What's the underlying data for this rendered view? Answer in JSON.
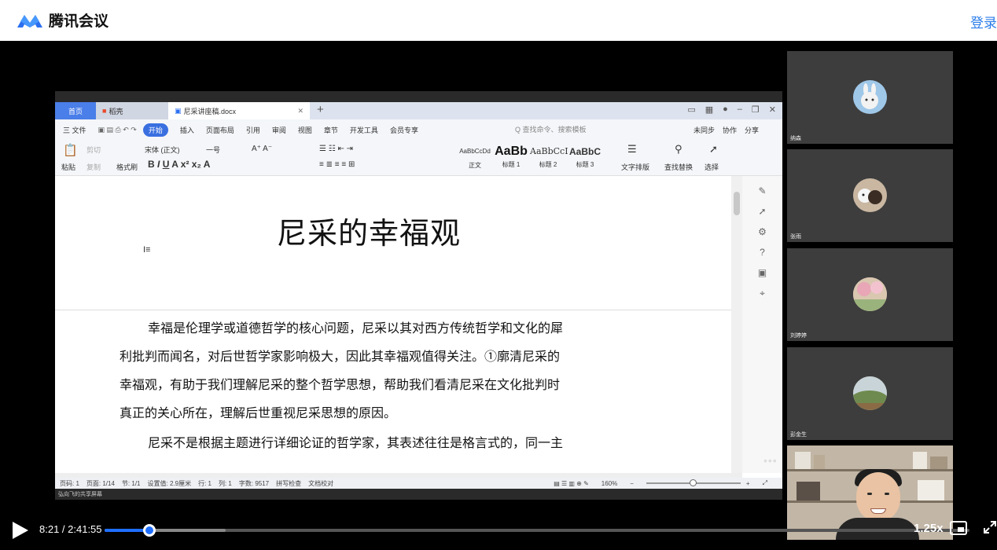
{
  "app": {
    "name": "腾讯会议",
    "login_label": "登录"
  },
  "wps": {
    "tabs": {
      "home": "首页",
      "daoke": "稻壳",
      "doc": "尼采讲座稿.docx"
    },
    "menu": [
      "三 文件",
      "开始",
      "插入",
      "页面布局",
      "引用",
      "审阅",
      "视图",
      "章节",
      "开发工具",
      "会员专享"
    ],
    "menu_active_index": 1,
    "search_placeholder": "Q 查找命令、搜索模板",
    "menu_right": [
      "未同步",
      "协作",
      "分享"
    ],
    "ribbon": {
      "paste": "粘贴",
      "cut": "剪切",
      "copy": "复制",
      "format_painter": "格式刷",
      "font_name": "宋体 (正文)",
      "font_size": "一号",
      "styles": [
        {
          "preview": "AaBbCcDd",
          "label": "正文"
        },
        {
          "preview": "AaBb",
          "label": "标题 1"
        },
        {
          "preview": "AaBbCcI",
          "label": "标题 2"
        },
        {
          "preview": "AaBbC",
          "label": "标题 3"
        }
      ],
      "text_layout": "文字排版",
      "find_replace": "查找替换",
      "select": "选择"
    },
    "document": {
      "title": "尼采的幸福观",
      "para1_lines": [
        "幸福是伦理学或道德哲学的核心问题，尼采以其对西方传统哲学和文化的犀",
        "利批判而闻名，对后世哲学家影响极大，因此其幸福观值得关注。①廓清尼采的",
        "幸福观，有助于我们理解尼采的整个哲学思想，帮助我们看清尼采在文化批判时",
        "真正的关心所在，理解后世重视尼采思想的原因。"
      ],
      "para2_lines": [
        "尼采不是根据主题进行详细论证的哲学家，其表述往往是格言式的，同一主"
      ]
    },
    "status": {
      "page": "页码: 1",
      "pages": "页面: 1/14",
      "section": "节: 1/1",
      "setting": "设置值: 2.9厘米",
      "row": "行: 1",
      "col": "列: 1",
      "words": "字数: 9517",
      "spell": "拼写检查",
      "proof": "文档校对",
      "zoom": "160%"
    },
    "share_caption": "​弘向飞的共享屏幕"
  },
  "participants": [
    {
      "name": "纳森",
      "avatar_color": "#9fc7e8"
    },
    {
      "name": "张雨",
      "avatar_color": "#c9b7a2"
    },
    {
      "name": "刘婷婷",
      "avatar_color": "#e6b8c4"
    },
    {
      "name": "彭金生",
      "avatar_color": "#7a8f6a"
    }
  ],
  "player": {
    "time": "8:21 / 2:41:55",
    "progress": 0.052,
    "speed": "1.25x"
  },
  "colors": {
    "brand": "#2b7de9",
    "progress": "#1f6fff",
    "wps_accent": "#3a6fe0"
  }
}
